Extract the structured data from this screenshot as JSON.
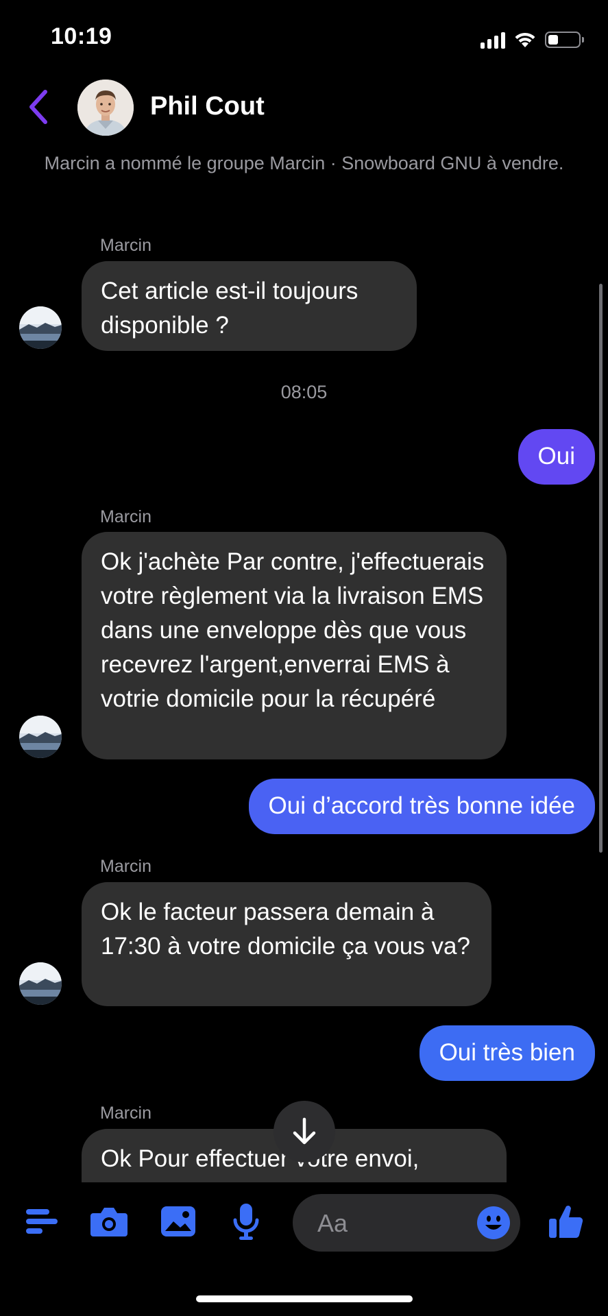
{
  "status_bar": {
    "time": "10:19"
  },
  "header": {
    "back_icon": "chevron-left-icon",
    "contact_name": "Phil Cout"
  },
  "system_note": "Marcin a nommé le groupe Marcin · Snowboard GNU à vendre.",
  "messages": [
    {
      "direction": "in",
      "sender": "Marcin",
      "text": "Cet article est-il toujours disponible ?"
    },
    {
      "type": "timestamp",
      "text": "08:05"
    },
    {
      "direction": "out",
      "text": "Oui"
    },
    {
      "direction": "in",
      "sender": "Marcin",
      "text": "Ok j'achète Par contre, j'effectuerais votre règlement via la livraison EMS dans une enveloppe dès que vous recevrez l'argent,enverrai EMS à votrie domicile pour la récupéré"
    },
    {
      "direction": "out",
      "text": "Oui d’accord très bonne idée"
    },
    {
      "direction": "in",
      "sender": "Marcin",
      "text": "Ok le facteur passera demain à 17:30 à votre domicile ça vous va?"
    },
    {
      "direction": "out",
      "text": "Oui très bien"
    },
    {
      "direction": "in",
      "sender": "Marcin",
      "text": "Ok Pour effectuer votre envoi,"
    }
  ],
  "composer": {
    "placeholder": "Aa"
  },
  "icons": {
    "menu": "menu-icon",
    "camera": "camera-icon",
    "gallery": "image-icon",
    "mic": "microphone-icon",
    "emoji": "emoji-icon",
    "like": "thumbs-up-icon",
    "scroll": "arrow-down-icon"
  },
  "colors": {
    "accent": "#3b6ef6",
    "purple_bubble": "#6248f2",
    "blue_bubble": "#3d6cf3",
    "incoming_bubble": "#303030",
    "back_chevron": "#7d3cf0"
  }
}
